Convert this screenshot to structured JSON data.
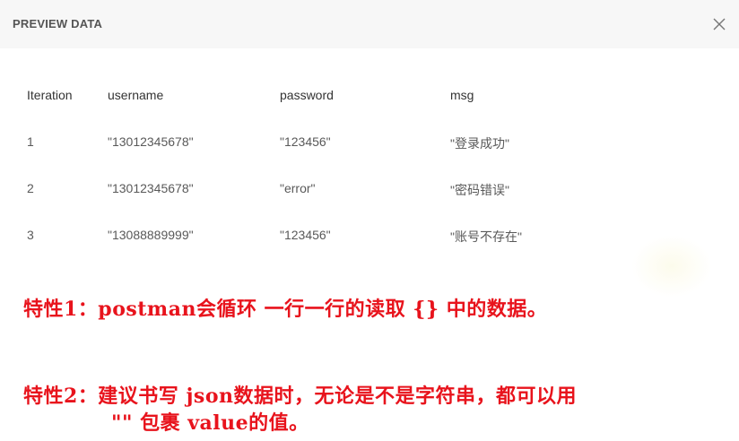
{
  "header": {
    "title": "PREVIEW DATA",
    "close_icon": "close-icon"
  },
  "table": {
    "columns": [
      "Iteration",
      "username",
      "password",
      "msg"
    ],
    "rows": [
      [
        "1",
        "\"13012345678\"",
        "\"123456\"",
        "\"登录成功\""
      ],
      [
        "2",
        "\"13012345678\"",
        "\"error\"",
        "\"密码错误\""
      ],
      [
        "3",
        "\"13088889999\"",
        "\"123456\"",
        "\"账号不存在\""
      ]
    ]
  },
  "annotations": {
    "note1": "特性1：postman会循环 一行一行的读取 {} 中的数据。",
    "note2_line1": "特性2：建议书写 json数据时，无论是不是字符串，都可以用",
    "note2_line2": "\"\" 包裹 value的值。",
    "color": "#e8131c"
  }
}
